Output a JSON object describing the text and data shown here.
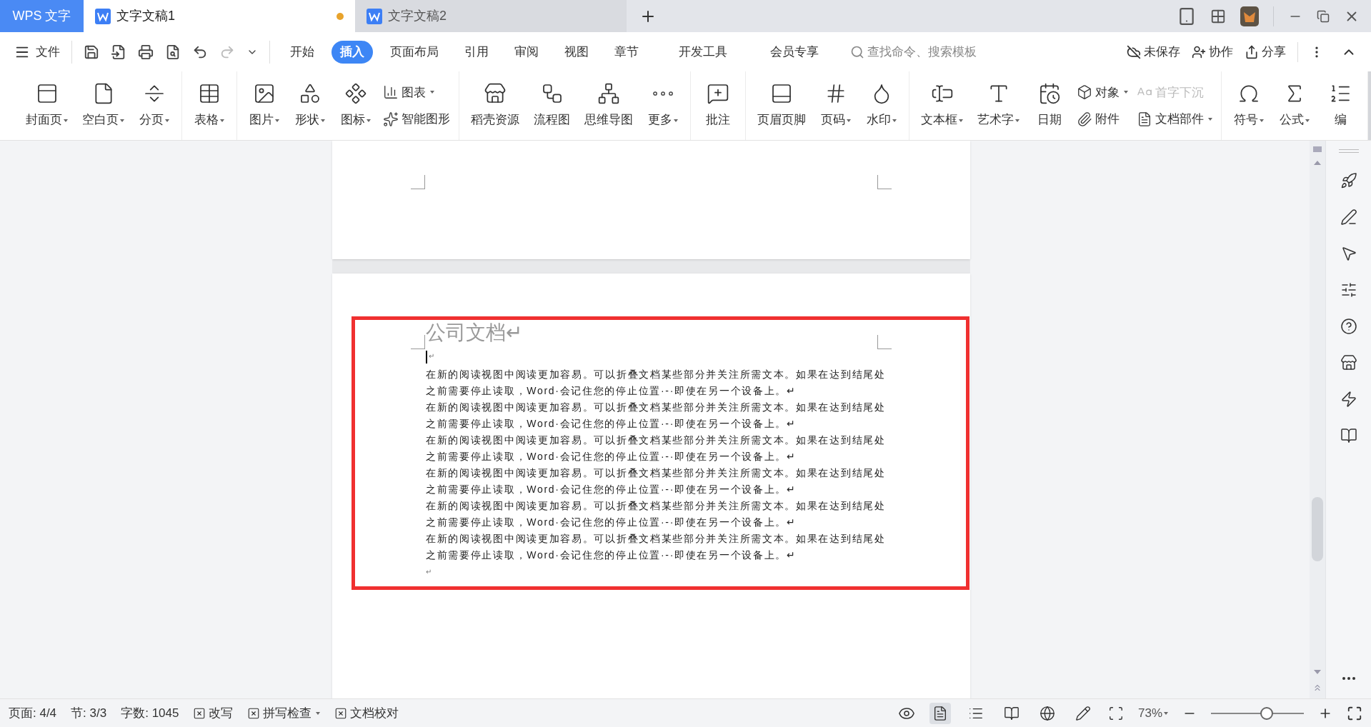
{
  "app_tab": "WPS 文字",
  "doc_tabs": [
    {
      "title": "文字文稿1",
      "selected": true,
      "modified": true
    },
    {
      "title": "文字文稿2",
      "selected": false,
      "modified": false
    }
  ],
  "file_menu": "文件",
  "menu_tabs": [
    {
      "label": "开始",
      "selected": false
    },
    {
      "label": "插入",
      "selected": true
    },
    {
      "label": "页面布局",
      "selected": false
    },
    {
      "label": "引用",
      "selected": false
    },
    {
      "label": "审阅",
      "selected": false
    },
    {
      "label": "视图",
      "selected": false
    },
    {
      "label": "章节",
      "selected": false
    },
    {
      "label": "开发工具",
      "selected": false
    },
    {
      "label": "会员专享",
      "selected": false
    }
  ],
  "search": {
    "placeholder": "查找命令、搜索模板"
  },
  "actions": [
    "未保存",
    "协作",
    "分享"
  ],
  "ribbon": [
    [
      {
        "kind": "big",
        "label": "封面页",
        "dropdown": true
      },
      {
        "kind": "big",
        "label": "空白页",
        "dropdown": true
      },
      {
        "kind": "big",
        "label": "分页",
        "dropdown": true
      }
    ],
    [
      {
        "kind": "big",
        "label": "表格",
        "dropdown": true
      }
    ],
    [
      {
        "kind": "big",
        "label": "图片",
        "dropdown": true
      },
      {
        "kind": "big",
        "label": "形状",
        "dropdown": true
      },
      {
        "kind": "big",
        "label": "图标",
        "dropdown": true
      },
      {
        "kind": "stack",
        "items": [
          {
            "label": "图表",
            "dropdown": true,
            "disabled": false
          },
          {
            "label": "智能图形",
            "dropdown": false,
            "disabled": false
          }
        ]
      }
    ],
    [
      {
        "kind": "big",
        "label": "稻壳资源",
        "dropdown": false
      },
      {
        "kind": "big",
        "label": "流程图",
        "dropdown": false
      },
      {
        "kind": "big",
        "label": "思维导图",
        "dropdown": false
      },
      {
        "kind": "big",
        "label": "更多",
        "dropdown": true
      }
    ],
    [
      {
        "kind": "big",
        "label": "批注",
        "dropdown": false
      }
    ],
    [
      {
        "kind": "big",
        "label": "页眉页脚",
        "dropdown": false
      },
      {
        "kind": "big",
        "label": "页码",
        "dropdown": true
      },
      {
        "kind": "big",
        "label": "水印",
        "dropdown": true
      }
    ],
    [
      {
        "kind": "big",
        "label": "文本框",
        "dropdown": true
      },
      {
        "kind": "big",
        "label": "艺术字",
        "dropdown": true
      },
      {
        "kind": "big",
        "label": "日期",
        "dropdown": false
      },
      {
        "kind": "stack",
        "items": [
          {
            "label": "对象",
            "dropdown": true,
            "disabled": false
          },
          {
            "label": "附件",
            "dropdown": false,
            "disabled": false
          }
        ]
      },
      {
        "kind": "stack",
        "items": [
          {
            "label": "首字下沉",
            "dropdown": false,
            "disabled": true
          },
          {
            "label": "文档部件",
            "dropdown": true,
            "disabled": false
          }
        ]
      }
    ],
    [
      {
        "kind": "big",
        "label": "符号",
        "dropdown": true
      },
      {
        "kind": "big",
        "label": "公式",
        "dropdown": true
      },
      {
        "kind": "big",
        "label": "编",
        "dropdown": false
      }
    ]
  ],
  "document": {
    "title": "公司文档↵",
    "empty_mark": "↵",
    "paragraphs": [
      {
        "lines": [
          "在新的阅读视图中阅读更加容易。可以折叠文档某些部分并关注所需文本。如果在达到结尾处",
          "之前需要停止读取，Word·会记住您的停止位置·-·即使在另一个设备上。↵"
        ]
      },
      {
        "lines": [
          "在新的阅读视图中阅读更加容易。可以折叠文档某些部分并关注所需文本。如果在达到结尾处",
          "之前需要停止读取，Word·会记住您的停止位置·-·即使在另一个设备上。↵"
        ]
      },
      {
        "lines": [
          "在新的阅读视图中阅读更加容易。可以折叠文档某些部分并关注所需文本。如果在达到结尾处",
          "之前需要停止读取，Word·会记住您的停止位置·-·即使在另一个设备上。↵"
        ]
      },
      {
        "lines": [
          "在新的阅读视图中阅读更加容易。可以折叠文档某些部分并关注所需文本。如果在达到结尾处",
          "之前需要停止读取，Word·会记住您的停止位置·-·即使在另一个设备上。↵"
        ]
      },
      {
        "lines": [
          "在新的阅读视图中阅读更加容易。可以折叠文档某些部分并关注所需文本。如果在达到结尾处",
          "之前需要停止读取，Word·会记住您的停止位置·-·即使在另一个设备上。↵"
        ]
      },
      {
        "lines": [
          "在新的阅读视图中阅读更加容易。可以折叠文档某些部分并关注所需文本。如果在达到结尾处",
          "之前需要停止读取，Word·会记住您的停止位置·-·即使在另一个设备上。↵"
        ]
      }
    ],
    "end_mark": "↵"
  },
  "status_bar": {
    "page": "页面: 4/4",
    "section": "节: 3/3",
    "words": "字数: 1045",
    "toggles": [
      {
        "label": "改写",
        "dropdown": false
      },
      {
        "label": "拼写检查",
        "dropdown": true
      },
      {
        "label": "文档校对",
        "dropdown": false
      }
    ],
    "views": [
      {
        "selected": true
      },
      {
        "selected": false
      },
      {
        "selected": false
      },
      {
        "selected": false
      },
      {
        "selected": false
      }
    ],
    "zoom": "73%",
    "zoom_slider": {
      "level": 0.6
    }
  }
}
